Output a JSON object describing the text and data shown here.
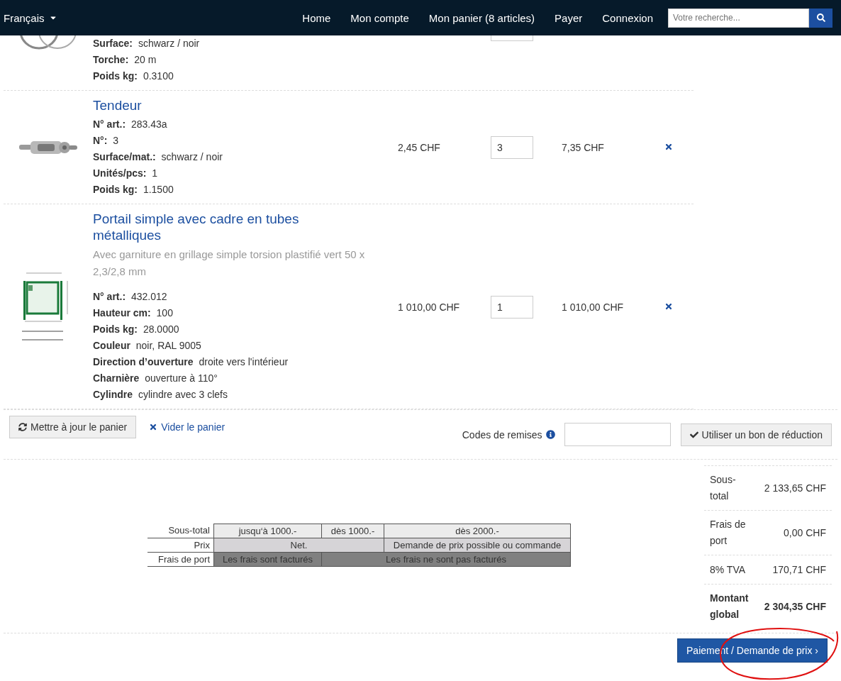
{
  "navbar": {
    "language": "Français",
    "links": [
      {
        "label": "Home"
      },
      {
        "label": "Mon compte"
      },
      {
        "label": "Mon panier (8 articles)"
      },
      {
        "label": "Payer"
      },
      {
        "label": "Connexion"
      }
    ],
    "search": {
      "placeholder": "Votre recherche..."
    }
  },
  "cart_items": [
    {
      "kind": "coil",
      "attributes": [
        {
          "label": "Surface:",
          "value": "schwarz / noir"
        },
        {
          "label": "Torche:",
          "value": "20 m"
        },
        {
          "label": "Poids kg:",
          "value": "0.3100"
        }
      ]
    },
    {
      "kind": "tensioner",
      "title": "Tendeur",
      "attributes": [
        {
          "label": "N° art.:",
          "value": "283.43a"
        },
        {
          "label": "N°:",
          "value": "3"
        },
        {
          "label": "Surface/mat.:",
          "value": "schwarz / noir"
        },
        {
          "label": "Unités/pcs:",
          "value": "1"
        },
        {
          "label": "Poids kg:",
          "value": "1.1500"
        }
      ],
      "price": "2,45 CHF",
      "quantity": "3",
      "total": "7,35 CHF"
    },
    {
      "kind": "gate",
      "title": "Portail simple avec cadre en tubes métalliques",
      "subtitle": "Avec garniture en grillage simple torsion plastifié vert 50 x 2,3/2,8 mm",
      "attributes": [
        {
          "label": "N° art.:",
          "value": "432.012"
        },
        {
          "label": "Hauteur cm:",
          "value": "100"
        },
        {
          "label": "Poids kg:",
          "value": "28.0000"
        },
        {
          "label": "Couleur",
          "value": "noir, RAL 9005"
        },
        {
          "label": "Direction d’ouverture",
          "value": "droite vers l'intérieur"
        },
        {
          "label": "Charnière",
          "value": "ouverture à 110°"
        },
        {
          "label": "Cylindre",
          "value": "cylindre avec 3 clefs"
        }
      ],
      "price": "1 010,00 CHF",
      "quantity": "1",
      "total": "1 010,00 CHF"
    }
  ],
  "actions": {
    "update_button": "Mettre à jour le panier",
    "empty_link": "Vider le panier",
    "discount_label": "Codes de remises",
    "discount_button": "Utiliser un bon de réduction"
  },
  "shipping_table": {
    "rows": [
      {
        "label": "Sous-total",
        "cells": [
          {
            "text": "jusqu‘à 1000.-",
            "wide": false
          },
          {
            "text": "dès 1000.-",
            "wide": false
          },
          {
            "text": "dès 2000.-",
            "wide": false
          }
        ]
      },
      {
        "label": "Prix",
        "cells": [
          {
            "text": "Net.",
            "wide": true
          },
          {
            "text": "Demande de prix possible ou commande",
            "wide": false
          }
        ]
      },
      {
        "label": "Frais de port",
        "cells": [
          {
            "text": "Les frais sont facturés",
            "wide": false
          },
          {
            "text": "Les frais ne sont pas facturés",
            "wide": true
          }
        ]
      }
    ]
  },
  "summary": [
    {
      "label": "Sous-total",
      "value": "2 133,65 CHF",
      "emphasis": false
    },
    {
      "label": "Frais de port",
      "value": "0,00 CHF",
      "emphasis": false
    },
    {
      "label": "8% TVA",
      "value": "170,71 CHF",
      "emphasis": false
    },
    {
      "label": "Montant global",
      "value": "2 304,35 CHF",
      "emphasis": true
    }
  ],
  "checkout_button": "Paiement / Demande de prix ›"
}
